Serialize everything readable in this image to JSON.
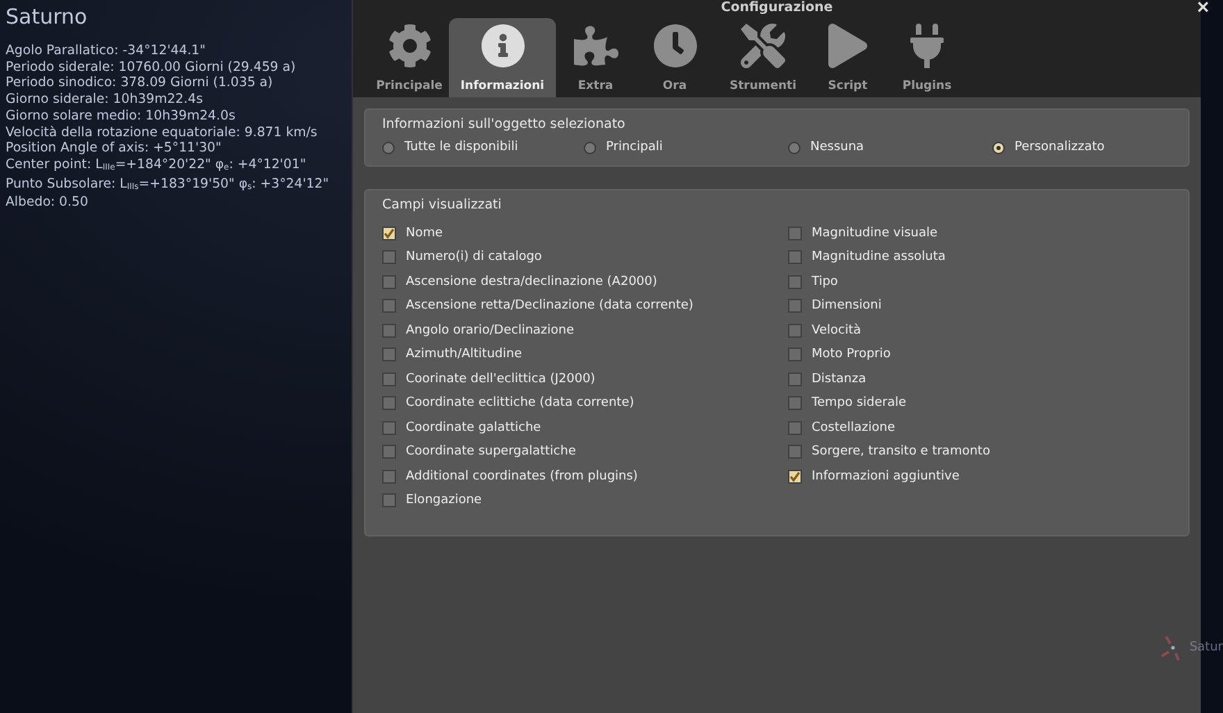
{
  "object_info": {
    "title": "Saturno",
    "lines": [
      "Agolo Parallatico: -34°12'44.1\"",
      "Periodo siderale: 10760.00 Giorni (29.459 a)",
      "Periodo sinodico: 378.09 Giorni (1.035 a)",
      "Giorno siderale: 10h39m22.4s",
      "Giorno solare medio: 10h39m24.0s",
      "Velocità della rotazione equatoriale: 9.871 km/s",
      "Position Angle of axis: +5°11'30\"",
      "Center point: L$_{IIIe}$=+184°20'22\" φ$_{e}$: +4°12'01\"",
      "Punto Subsolare: L$_{IIIs}$=+183°19'50\" φ$_{s}$: +3°24'12\"",
      "Albedo: 0.50"
    ]
  },
  "sky_label": "Satur",
  "window": {
    "title": "Configurazione",
    "close": "×"
  },
  "tabs": [
    {
      "label": "Principale",
      "selected": false
    },
    {
      "label": "Informazioni",
      "selected": true
    },
    {
      "label": "Extra",
      "selected": false
    },
    {
      "label": "Ora",
      "selected": false
    },
    {
      "label": "Strumenti",
      "selected": false
    },
    {
      "label": "Script",
      "selected": false
    },
    {
      "label": "Plugins",
      "selected": false
    }
  ],
  "selection_group": {
    "title": "Informazioni sull'oggetto selezionato",
    "options": [
      {
        "label": "Tutte le disponibili",
        "selected": false
      },
      {
        "label": "Principali",
        "selected": false
      },
      {
        "label": "Nessuna",
        "selected": false
      },
      {
        "label": "Personalizzato",
        "selected": true
      }
    ]
  },
  "fields_group": {
    "title": "Campi visualizzati",
    "columns": [
      [
        {
          "label": "Nome",
          "checked": true
        },
        {
          "label": "Numero(i) di catalogo",
          "checked": false
        },
        {
          "label": "Ascensione destra/declinazione (A2000)",
          "checked": false
        },
        {
          "label": "Ascensione retta/Declinazione (data corrente)",
          "checked": false
        },
        {
          "label": "Angolo orario/Declinazione",
          "checked": false
        },
        {
          "label": "Azimuth/Altitudine",
          "checked": false
        },
        {
          "label": "Coorinate dell'eclittica (J2000)",
          "checked": false
        },
        {
          "label": "Coordinate eclittiche (data corrente)",
          "checked": false
        },
        {
          "label": "Coordinate galattiche",
          "checked": false
        },
        {
          "label": "Coordinate supergalattiche",
          "checked": false
        },
        {
          "label": "Additional coordinates (from plugins)",
          "checked": false
        },
        {
          "label": "Elongazione",
          "checked": false
        }
      ],
      [
        {
          "label": "Magnitudine visuale",
          "checked": false
        },
        {
          "label": "Magnitudine assoluta",
          "checked": false
        },
        {
          "label": "Tipo",
          "checked": false
        },
        {
          "label": "Dimensioni",
          "checked": false
        },
        {
          "label": "Velocità",
          "checked": false
        },
        {
          "label": "Moto Proprio",
          "checked": false
        },
        {
          "label": "Distanza",
          "checked": false
        },
        {
          "label": "Tempo siderale",
          "checked": false
        },
        {
          "label": "Costellazione",
          "checked": false
        },
        {
          "label": "Sorgere, transito e tramonto",
          "checked": false
        },
        {
          "label": "Informazioni aggiuntive",
          "checked": true
        }
      ]
    ]
  }
}
